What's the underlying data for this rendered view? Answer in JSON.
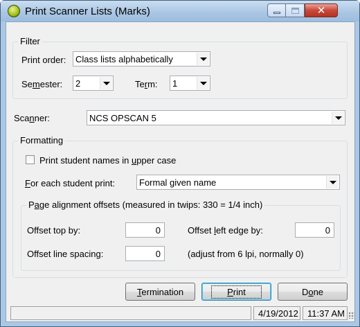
{
  "window": {
    "title": "Print Scanner Lists (Marks)",
    "controls": {
      "minimize": "minimize",
      "maximize": "maximize",
      "close": "✕"
    }
  },
  "filter": {
    "group_label": "Filter",
    "print_order_label": "Print order:",
    "print_order_value": "Class lists alphabetically",
    "semester_label": "Semester:",
    "semester_value": "2",
    "term_label": "Term:",
    "term_value": "1"
  },
  "scanner": {
    "label": "Scanner:",
    "value": "NCS OPSCAN 5"
  },
  "formatting": {
    "group_label": "Formatting",
    "uppercase_label": "Print student names in upper case",
    "uppercase_checked": false,
    "each_student_label": "For each student print:",
    "each_student_value": "Formal given name",
    "offsets": {
      "group_label": "Page alignment offsets  (measured in twips: 330 = 1/4 inch)",
      "top_label": "Offset top by:",
      "top_value": "0",
      "left_label": "Offset left edge by:",
      "left_value": "0",
      "line_label": "Offset line spacing:",
      "line_value": "0",
      "line_note": "(adjust from 6 lpi, normally 0)"
    }
  },
  "buttons": {
    "termination": "Termination",
    "print": "Print",
    "done": "Done"
  },
  "statusbar": {
    "message": "",
    "date": "4/19/2012",
    "time": "11:37 AM"
  },
  "colors": {
    "title_bar": "#a9c5e3",
    "close_button": "#c8493a",
    "dialog_bg": "#f0f0f0"
  }
}
